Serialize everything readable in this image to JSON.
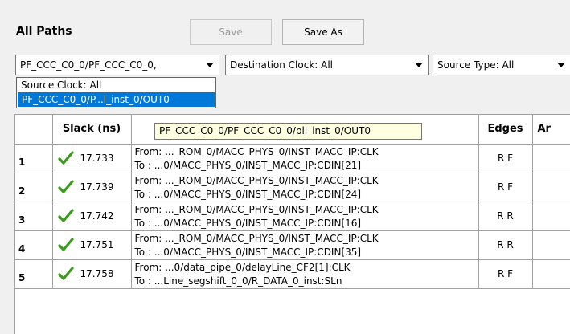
{
  "panel": {
    "title": "All Paths"
  },
  "toolbar": {
    "save_label": "Save",
    "save_as_label": "Save As"
  },
  "filters": {
    "source_clock_value": "PF_CCC_C0_0/PF_CCC_C0_0,",
    "destination_clock_value": "Destination Clock: All",
    "source_type_value": "Source Type: All"
  },
  "source_clock_options": [
    {
      "label": "Source Clock: All"
    },
    {
      "label": "PF_CCC_C0_0/P...l_inst_0/OUT0"
    }
  ],
  "tooltip": {
    "text": "PF_CCC_C0_0/PF_CCC_C0_0/pll_inst_0/OUT0"
  },
  "table": {
    "headers": {
      "index": "",
      "slack": "Slack (ns)",
      "path": "",
      "edges": "Edges",
      "next": "Ar"
    },
    "rows": [
      {
        "index": "1",
        "slack": "17.733",
        "from": "From: ..._ROM_0/MACC_PHYS_0/INST_MACC_IP:CLK",
        "to": "To    : ...0/MACC_PHYS_0/INST_MACC_IP:CDIN[21]",
        "edges": "R F"
      },
      {
        "index": "2",
        "slack": "17.739",
        "from": "From: ..._ROM_0/MACC_PHYS_0/INST_MACC_IP:CLK",
        "to": "To    : ...0/MACC_PHYS_0/INST_MACC_IP:CDIN[24]",
        "edges": "R F"
      },
      {
        "index": "3",
        "slack": "17.742",
        "from": "From: ..._ROM_0/MACC_PHYS_0/INST_MACC_IP:CLK",
        "to": "To    : ...0/MACC_PHYS_0/INST_MACC_IP:CDIN[16]",
        "edges": "R R"
      },
      {
        "index": "4",
        "slack": "17.751",
        "from": "From: ..._ROM_0/MACC_PHYS_0/INST_MACC_IP:CLK",
        "to": "To    : ...0/MACC_PHYS_0/INST_MACC_IP:CDIN[35]",
        "edges": "R R"
      },
      {
        "index": "5",
        "slack": "17.758",
        "from": "From: ...0/data_pipe_0/delayLine_CF2[1]:CLK",
        "to": "To    : ...Line_segshift_0_0/R_DATA_0_inst:SLn",
        "edges": "R F"
      }
    ]
  },
  "icons": {
    "check": "green-checkmark-icon"
  },
  "colors": {
    "check_green": "#3a9a1c",
    "selection": "#0078d7",
    "tooltip_bg": "#ffffe1"
  }
}
